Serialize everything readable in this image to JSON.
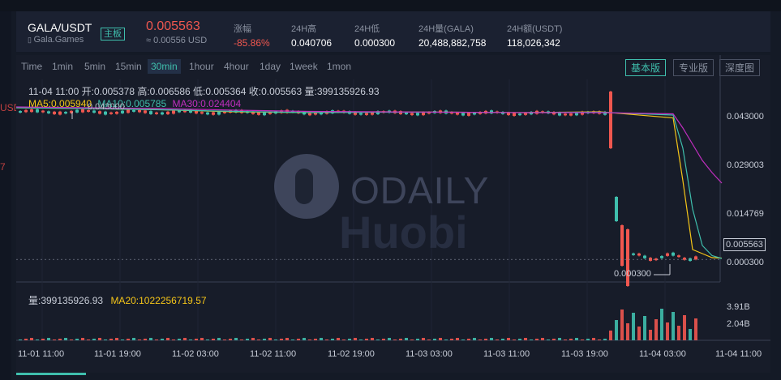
{
  "ticker": {
    "symbol": "GALA/USDT",
    "badge": "主板",
    "subtitle": "Gala.Games",
    "price": "0.005563",
    "usd": "≈ 0.00556 USD",
    "stats": [
      {
        "label": "涨幅",
        "value": "-85.86%",
        "red": true
      },
      {
        "label": "24H高",
        "value": "0.040706"
      },
      {
        "label": "24H低",
        "value": "0.000300"
      },
      {
        "label": "24H量(GALA)",
        "value": "20,488,882,758"
      },
      {
        "label": "24H额(USDT)",
        "value": "118,026,342"
      }
    ]
  },
  "side": {
    "a": "USD",
    "b": "7"
  },
  "toolbar": {
    "timeframes": [
      "Time",
      "1min",
      "5min",
      "15min",
      "30min",
      "1hour",
      "4hour",
      "1day",
      "1week",
      "1mon"
    ],
    "active": "30min",
    "views": [
      "基本版",
      "专业版",
      "深度图"
    ],
    "active_view": "基本版"
  },
  "info": {
    "line": "11-04 11:00   开:0.005378  高:0.006586  低:0.005364  收:0.005563  量:399135926.93"
  },
  "ma": {
    "ma5": "MA5:0.005940",
    "ma10": "MA10:0.005785",
    "ma30": "MA30:0.024404",
    "ma5_color": "#f5c518",
    "ma10_color": "#3fbfad",
    "ma30_color": "#c02ebf"
  },
  "volume": {
    "text": "量:399135926.93",
    "ma20": "MA20:1022256719.57",
    "axis": [
      "3.91B",
      "2.04B"
    ]
  },
  "watermark": {
    "brand": "ODAILY",
    "source": "Huobi"
  },
  "annotations": {
    "high": "0.043000",
    "low": "0.000300",
    "current": "0.005563"
  },
  "colors": {
    "up": "#3fbfad",
    "down": "#f0574f",
    "accent": "#3fbfad"
  },
  "chart_data": {
    "type": "candlestick",
    "price_axis": [
      "0.043000",
      "0.029003",
      "0.014769",
      "0.005563",
      "0.000300"
    ],
    "time_axis": [
      "11-01 11:00",
      "11-01 19:00",
      "11-02 03:00",
      "11-02 11:00",
      "11-02 19:00",
      "11-03 03:00",
      "11-03 11:00",
      "11-03 19:00",
      "11-04 03:00",
      "11-04 11:00"
    ],
    "ylim": [
      0.0,
      0.05
    ],
    "series": [
      {
        "name": "MA5",
        "values": [
          0.043,
          0.0428,
          0.0425,
          0.042,
          0.0418,
          0.042,
          0.0419,
          0.0418,
          0.042,
          0.0405,
          0.025,
          0.008,
          0.007,
          0.006,
          0.0059
        ]
      },
      {
        "name": "MA10",
        "values": [
          0.043,
          0.0428,
          0.0425,
          0.0421,
          0.0418,
          0.0419,
          0.0419,
          0.0418,
          0.0419,
          0.0412,
          0.033,
          0.018,
          0.009,
          0.0065,
          0.0058
        ]
      },
      {
        "name": "MA30",
        "values": [
          0.0432,
          0.043,
          0.0428,
          0.0424,
          0.0421,
          0.042,
          0.0419,
          0.0418,
          0.0418,
          0.0415,
          0.038,
          0.034,
          0.03,
          0.027,
          0.0244
        ]
      }
    ]
  }
}
